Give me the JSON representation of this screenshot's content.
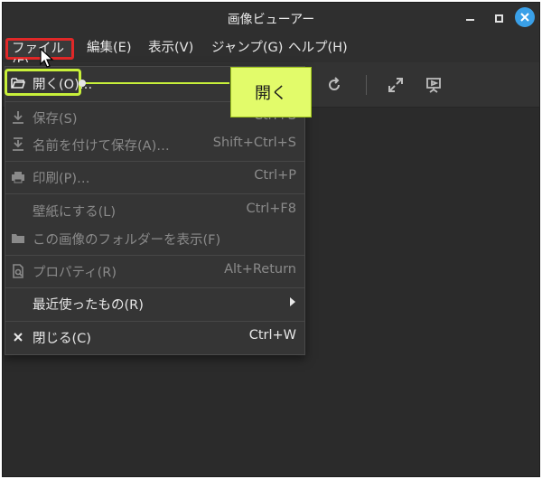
{
  "window": {
    "title": "画像ビューアー"
  },
  "menubar": {
    "file": "ファイル(F)",
    "edit": "編集(E)",
    "view": "表示(V)",
    "go": "ジャンプ(G)",
    "help": "ヘルプ(H)"
  },
  "file_menu": {
    "open": {
      "label": "開く(O)…",
      "shortcut": "",
      "icon": "folder-open-icon"
    },
    "save": {
      "label": "保存(S)",
      "shortcut": "Ctrl+S",
      "icon": "save-icon"
    },
    "save_as": {
      "label": "名前を付けて保存(A)…",
      "shortcut": "Shift+Ctrl+S",
      "icon": "save-as-icon"
    },
    "print": {
      "label": "印刷(P)…",
      "shortcut": "Ctrl+P",
      "icon": "printer-icon"
    },
    "wallpaper": {
      "label": "壁紙にする(L)",
      "shortcut": "Ctrl+F8"
    },
    "show_folder": {
      "label": "この画像のフォルダーを表示(F)",
      "shortcut": "",
      "icon": "folder-icon"
    },
    "properties": {
      "label": "プロパティ(R)",
      "shortcut": "Alt+Return",
      "icon": "properties-icon"
    },
    "recent": {
      "label": "最近使ったもの(R)",
      "icon": "submenu-arrow-icon"
    },
    "close": {
      "label": "閉じる(C)",
      "shortcut": "Ctrl+W",
      "icon": "close-icon"
    }
  },
  "annotation": {
    "callout_text": "開く"
  },
  "colors": {
    "window_bg": "#2b2b2b",
    "highlight_red": "#e02828",
    "highlight_green": "#c8f03a",
    "callout_bg": "#e2fb6a",
    "close_button": "#3aa0e8"
  }
}
